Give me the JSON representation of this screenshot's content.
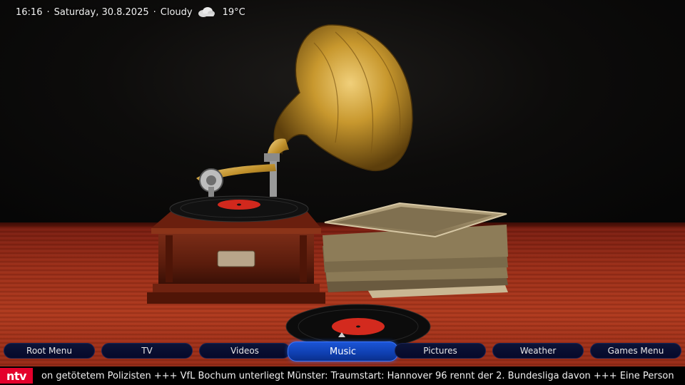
{
  "status_bar": {
    "time": "16:16",
    "date": "Saturday, 30.8.2025",
    "weather": "Cloudy",
    "weather_icon": "cloud-icon",
    "temperature": "19°C"
  },
  "menu": {
    "items": [
      {
        "label": "Root Menu"
      },
      {
        "label": "TV"
      },
      {
        "label": "Videos"
      },
      {
        "label": "Music",
        "active": true
      },
      {
        "label": "Pictures"
      },
      {
        "label": "Weather"
      },
      {
        "label": "Games Menu"
      }
    ],
    "active_color": "#1b55d6",
    "inactive_color": "#0c1438"
  },
  "ticker": {
    "logo": "ntv",
    "logo_color": "#e4002b",
    "text": "on getötetem Polizisten +++ VfL Bochum unterliegt Münster: Traumstart: Hannover 96 rennt der 2. Bundesliga davon +++ Eine Person st"
  },
  "background": {
    "description_icon": "gramophone-icon"
  }
}
